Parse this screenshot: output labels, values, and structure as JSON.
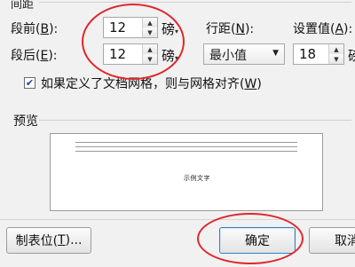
{
  "spacing": {
    "section_title": "间距",
    "before": {
      "label": "段前(",
      "key": "B",
      "suffix": "):",
      "value": "12",
      "unit": "磅"
    },
    "after": {
      "label": "段后(",
      "key": "E",
      "suffix": "):",
      "value": "12",
      "unit": "磅"
    },
    "line_spacing": {
      "label": "行距(",
      "key": "N",
      "suffix": "):",
      "value": "最小值"
    },
    "setting_value": {
      "label": "设置值(",
      "key": "A",
      "suffix": "):",
      "value": "18",
      "unit": "磅"
    },
    "grid_checkbox": {
      "label": "如果定义了文档网格，则与网格对齐(",
      "key": "W",
      "suffix": ")",
      "checked": true
    }
  },
  "preview": {
    "title": "预览",
    "sample_text": "示例文字"
  },
  "footer": {
    "tabs_button": {
      "label": "制表位(",
      "key": "T",
      "suffix": ")..."
    },
    "ok_button": "确定",
    "cancel_button": "取消"
  }
}
